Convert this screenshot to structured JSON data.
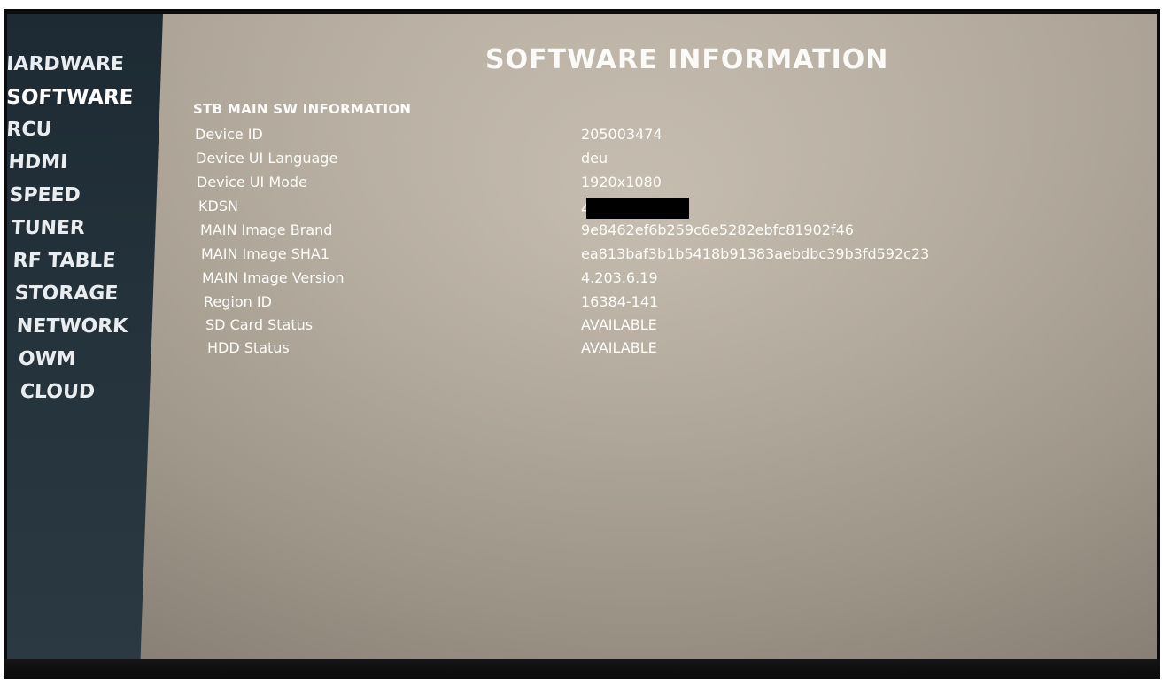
{
  "page_title": "SOFTWARE INFORMATION",
  "section_title": "STB MAIN SW INFORMATION",
  "sidebar": {
    "items": [
      {
        "label": "IARDWARE",
        "active": false
      },
      {
        "label": "SOFTWARE",
        "active": true
      },
      {
        "label": "RCU",
        "active": false
      },
      {
        "label": "HDMI",
        "active": false
      },
      {
        "label": "SPEED",
        "active": false
      },
      {
        "label": "TUNER",
        "active": false
      },
      {
        "label": "RF TABLE",
        "active": false
      },
      {
        "label": "STORAGE",
        "active": false
      },
      {
        "label": "NETWORK",
        "active": false
      },
      {
        "label": "OWM",
        "active": false
      },
      {
        "label": "CLOUD",
        "active": false
      }
    ]
  },
  "info": {
    "rows": [
      {
        "label": "Device ID",
        "value": "205003474"
      },
      {
        "label": "Device UI Language",
        "value": "deu"
      },
      {
        "label": "Device UI Mode",
        "value": "1920x1080"
      },
      {
        "label": "KDSN",
        "value": "4",
        "redacted": true
      },
      {
        "label": "MAIN Image Brand",
        "value": "9e8462ef6b259c6e5282ebfc81902f46"
      },
      {
        "label": "MAIN Image SHA1",
        "value": "ea813baf3b1b5418b91383aebdbc39b3fd592c23"
      },
      {
        "label": "MAIN Image Version",
        "value": "4.203.6.19"
      },
      {
        "label": "Region ID",
        "value": "16384-141"
      },
      {
        "label": "SD Card Status",
        "value": "AVAILABLE"
      },
      {
        "label": "HDD Status",
        "value": "AVAILABLE"
      }
    ]
  },
  "colors": {
    "sidebar_bg": "#24323b",
    "screen_bg": "#b8aea1",
    "text": "#fdfcf9"
  }
}
